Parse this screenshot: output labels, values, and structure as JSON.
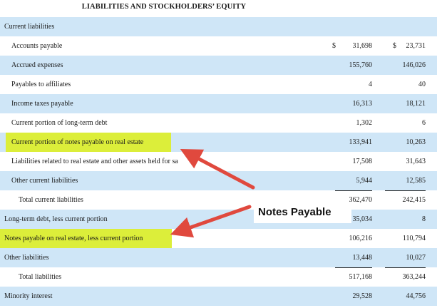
{
  "title": "LIABILITIES AND STOCKHOLDERS’ EQUITY",
  "rows": [
    {
      "label": "Current liabilities",
      "c1": "",
      "c2": ""
    },
    {
      "label": "Accounts payable",
      "c1": "31,698",
      "c2": "23,731",
      "c1_prefix": "$",
      "c2_prefix": "$"
    },
    {
      "label": "Accrued expenses",
      "c1": "155,760",
      "c2": "146,026"
    },
    {
      "label": "Payables to affiliates",
      "c1": "4",
      "c2": "40"
    },
    {
      "label": "Income taxes payable",
      "c1": "16,313",
      "c2": "18,121"
    },
    {
      "label": "Current portion of long-term debt",
      "c1": "1,302",
      "c2": "6"
    },
    {
      "label": "Current portion of notes payable on real estate",
      "c1": "133,941",
      "c2": "10,263"
    },
    {
      "label": "Liabilities related to real estate and other assets held for sa",
      "c1": "17,508",
      "c2": "31,643"
    },
    {
      "label": "Other current liabilities",
      "c1": "5,944",
      "c2": "12,585"
    },
    {
      "label": "Total current liabilities",
      "c1": "362,470",
      "c2": "242,415"
    },
    {
      "label": "Long-term debt, less current portion",
      "c1": "35,034",
      "c2": "8"
    },
    {
      "label": "Notes payable on real estate, less current portion",
      "c1": "106,216",
      "c2": "110,794"
    },
    {
      "label": "Other liabilities",
      "c1": "13,448",
      "c2": "10,027"
    },
    {
      "label": "Total liabilities",
      "c1": "517,168",
      "c2": "363,244"
    },
    {
      "label": "Minority interest",
      "c1": "29,528",
      "c2": "44,756"
    }
  ],
  "callout": "Notes Payable",
  "colors": {
    "row_band": "#cfe6f7",
    "highlight": "#dcee3a",
    "arrow": "#e0493e"
  }
}
